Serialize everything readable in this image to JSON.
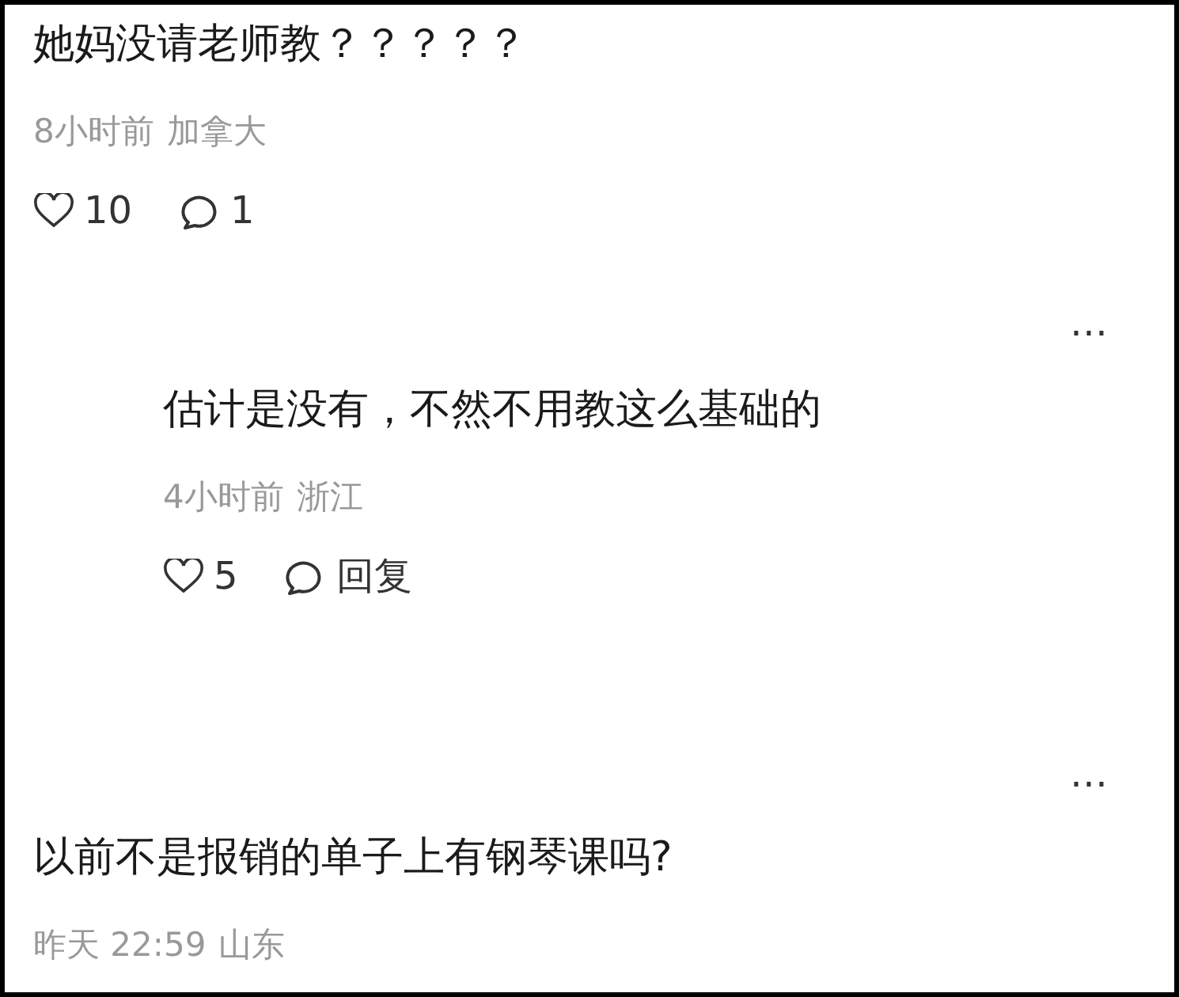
{
  "comments": [
    {
      "kind": "comment",
      "text": "她妈没请老师教？？？？？",
      "time": "8小时前",
      "location": "加拿大",
      "likes": "10",
      "reply": "1"
    },
    {
      "kind": "reply",
      "more": "…",
      "text": "估计是没有，不然不用教这么基础的",
      "time": "4小时前",
      "location": "浙江",
      "likes": "5",
      "reply": "回复"
    },
    {
      "kind": "comment",
      "more": "…",
      "text": "以前不是报销的单子上有钢琴课吗?",
      "time": "昨天 22:59",
      "location": "山东"
    }
  ]
}
